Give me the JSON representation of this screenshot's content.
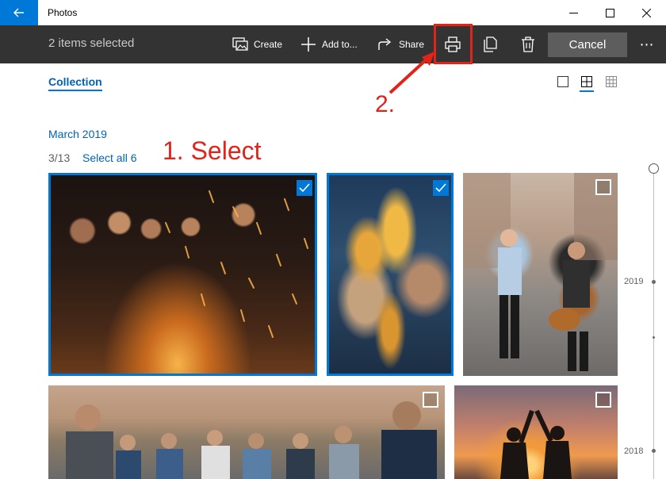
{
  "window": {
    "title": "Photos",
    "controls": [
      "minimize-icon",
      "maximize-icon",
      "close-icon"
    ]
  },
  "toolbar": {
    "selection_text": "2 items selected",
    "create_label": "Create",
    "add_to_label": "Add to...",
    "share_label": "Share",
    "cancel_label": "Cancel",
    "more_label": "⋯",
    "icons": [
      "slideshow-create-icon",
      "plus-icon",
      "share-icon",
      "print-icon",
      "copy-icon",
      "trash-icon"
    ]
  },
  "nav": {
    "collection_label": "Collection",
    "view_options": [
      "large-tiles-icon",
      "medium-grid-icon",
      "small-grid-icon"
    ],
    "active_view": "medium-grid-icon"
  },
  "annotations": {
    "step1": "1. Select",
    "step2": "2.",
    "color": "#e2231a"
  },
  "gallery": {
    "month": "March 2019",
    "count": "3/13",
    "select_all_label": "Select all 6",
    "photos": [
      {
        "name": "campfire-group-photo",
        "selected": true
      },
      {
        "name": "beer-toast-photo",
        "selected": true
      },
      {
        "name": "guitar-couple-photo",
        "selected": false
      },
      {
        "name": "friends-outdoor-photo",
        "selected": false
      },
      {
        "name": "sunset-high-five-photo",
        "selected": false
      }
    ]
  },
  "timeline": {
    "years": [
      "2019",
      "2018"
    ]
  },
  "colors": {
    "accent": "#0078d7",
    "link": "#0063b1",
    "toolbar_bg": "#333333",
    "cancel_bg": "#5d5d5d",
    "highlight_red": "#e2231a"
  }
}
